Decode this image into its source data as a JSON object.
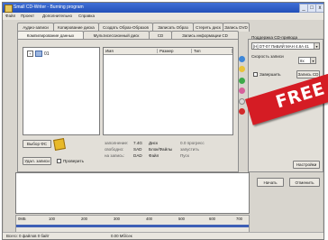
{
  "window": {
    "title": "Small CD-Writer - Burning program",
    "min": "_",
    "max": "□",
    "close": "x"
  },
  "menu": [
    "Файл",
    "Проект",
    "Дополнительно",
    "Справка"
  ],
  "tabs_row1": [
    "Аудио-записи",
    "Копирование диска",
    "Создать Образ-Образов",
    "Записать Образ",
    "Стереть диск",
    "Запись DVD"
  ],
  "tabs_row2": [
    "Компилирование данных",
    "Мультисессионный диск",
    "CD",
    "Запись информации CD"
  ],
  "tree": {
    "node_label": "01",
    "expander": "+"
  },
  "files": {
    "columns": [
      "Имя",
      "Размер",
      "Тип"
    ]
  },
  "left_buttons": {
    "select_folder": "Выбор ФС",
    "delete": "Удал. записи",
    "check_label": "Проверить"
  },
  "info": {
    "labels": [
      "заполнение:",
      "свободно:",
      "на запись:"
    ],
    "values_a": [
      "7.4G",
      "SAD",
      "DAD"
    ],
    "values_b": [
      "Диск",
      "Блок/Файлы",
      "Файл"
    ],
    "values_c": [
      "0.0 прогресс",
      "запустить",
      "Пуск"
    ]
  },
  "right": {
    "label_drive": "Поддержка CD-привода",
    "drive_value": "[H] DT-07 ПиБИЙ MAH 4.8A 41",
    "speed_label": "Скорость записи",
    "speed_value": "8x",
    "finalize_label": "Завершить",
    "write_options": "Запись CD",
    "params_button": "Настройки",
    "start_button": "Начать",
    "stop_button": "Отменить"
  },
  "ruler": {
    "ticks": [
      "0МБ",
      "100",
      "200",
      "300",
      "400",
      "500",
      "600",
      "700"
    ]
  },
  "status": {
    "left": "Всего: 0 файлов 0 байт",
    "mid": "0.00 Мб/сек"
  },
  "banner": {
    "text": "FREE",
    "color": "#d51c24"
  }
}
